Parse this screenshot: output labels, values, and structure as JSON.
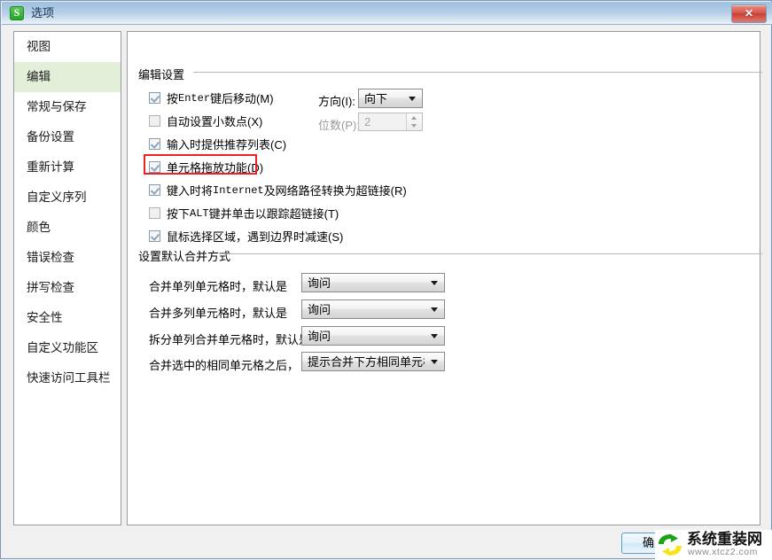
{
  "window": {
    "title": "选项",
    "app_icon_letter": "S",
    "close_label": "✕",
    "accent_green": "#22a522",
    "titlebar_blue": "#b2cde6",
    "highlight_red": "#ee2222",
    "selected_item_bg": "#e4efd9"
  },
  "sidebar": {
    "items": [
      {
        "label": "视图",
        "selected": false
      },
      {
        "label": "编辑",
        "selected": true
      },
      {
        "label": "常规与保存",
        "selected": false
      },
      {
        "label": "备份设置",
        "selected": false
      },
      {
        "label": "重新计算",
        "selected": false
      },
      {
        "label": "自定义序列",
        "selected": false
      },
      {
        "label": "颜色",
        "selected": false
      },
      {
        "label": "错误检查",
        "selected": false
      },
      {
        "label": "拼写检查",
        "selected": false
      },
      {
        "label": "安全性",
        "selected": false
      },
      {
        "label": "自定义功能区",
        "selected": false
      },
      {
        "label": "快速访问工具栏",
        "selected": false
      }
    ]
  },
  "edit_settings": {
    "group_title": "编辑设置",
    "checkboxes": [
      {
        "pre": "按 ",
        "mono": "Enter",
        "post": " 键后移动(M)",
        "checked": true,
        "enabled": true,
        "highlighted": false
      },
      {
        "pre": "自动设置小数点(X)",
        "mono": "",
        "post": "",
        "checked": false,
        "enabled": true,
        "highlighted": false
      },
      {
        "pre": "输入时提供推荐列表(C)",
        "mono": "",
        "post": "",
        "checked": true,
        "enabled": true,
        "highlighted": false
      },
      {
        "pre": "单元格拖放功能(D)",
        "mono": "",
        "post": "",
        "checked": true,
        "enabled": true,
        "highlighted": true
      },
      {
        "pre": "键入时将 ",
        "mono": "Internet",
        "post": " 及网络路径转换为超链接(R)",
        "checked": true,
        "enabled": true,
        "highlighted": false
      },
      {
        "pre": "按下 ",
        "mono": "ALT",
        "post": " 键并单击以跟踪超链接(T)",
        "checked": false,
        "enabled": true,
        "highlighted": false
      },
      {
        "pre": "鼠标选择区域，遇到边界时减速(S)",
        "mono": "",
        "post": "",
        "checked": true,
        "enabled": true,
        "highlighted": false
      }
    ],
    "direction_label": "方向(I):",
    "direction_value": "向下",
    "decimals_label": "位数(P):",
    "decimals_value": "2"
  },
  "merge_settings": {
    "group_title": "设置默认合并方式",
    "rows": [
      {
        "label": "合并单列单元格时，默认是",
        "value": "询问"
      },
      {
        "label": "合并多列单元格时，默认是",
        "value": "询问"
      },
      {
        "label": "拆分单列合并单元格时，默认是",
        "value": "询问"
      },
      {
        "label": "合并选中的相同单元格之后，",
        "value": "提示合并下方相同单元格"
      }
    ]
  },
  "footer": {
    "ok_label": "确定"
  },
  "watermark": {
    "title": "系统重装网",
    "url": "www.xtcz2.com"
  }
}
